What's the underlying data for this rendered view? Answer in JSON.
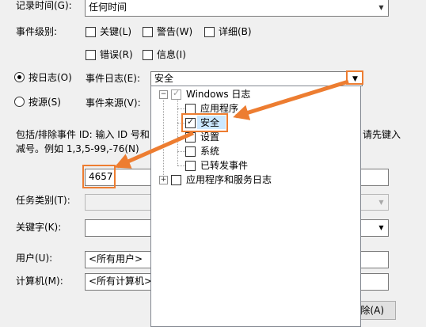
{
  "form": {
    "logged_label": "记录时间(G):",
    "logged_value": "任何时间",
    "level_label": "事件级别:",
    "levels": [
      "关键(L)",
      "警告(W)",
      "详细(B)",
      "错误(R)",
      "信息(I)"
    ],
    "by_log_label": "按日志(O)",
    "event_log_label": "事件日志(E):",
    "event_log_value": "安全",
    "by_source_label": "按源(S)",
    "event_source_label": "事件来源(V):",
    "include_text_1a": "包括/排除事件 ID: 输入 ID 号和",
    "include_text_1b": "请先键入",
    "include_text_2": "减号。例如 1,3,5-99,-76(N)",
    "event_id_value": "4657",
    "task_category_label": "任务类别(T):",
    "keywords_label": "关键字(K):",
    "user_label": "用户(U):",
    "user_value": "<所有用户>",
    "computer_label": "计算机(M):",
    "computer_value": "<所有计算机>",
    "clear_button": "除(A)"
  },
  "tree": {
    "windows_logs": "Windows 日志",
    "items": [
      "应用程序",
      "安全",
      "设置",
      "系统",
      "已转发事件"
    ],
    "app_service_logs": "应用程序和服务日志",
    "checked_item": "安全"
  },
  "colors": {
    "accent": "#ed7d31",
    "selection": "#cce8ff"
  }
}
